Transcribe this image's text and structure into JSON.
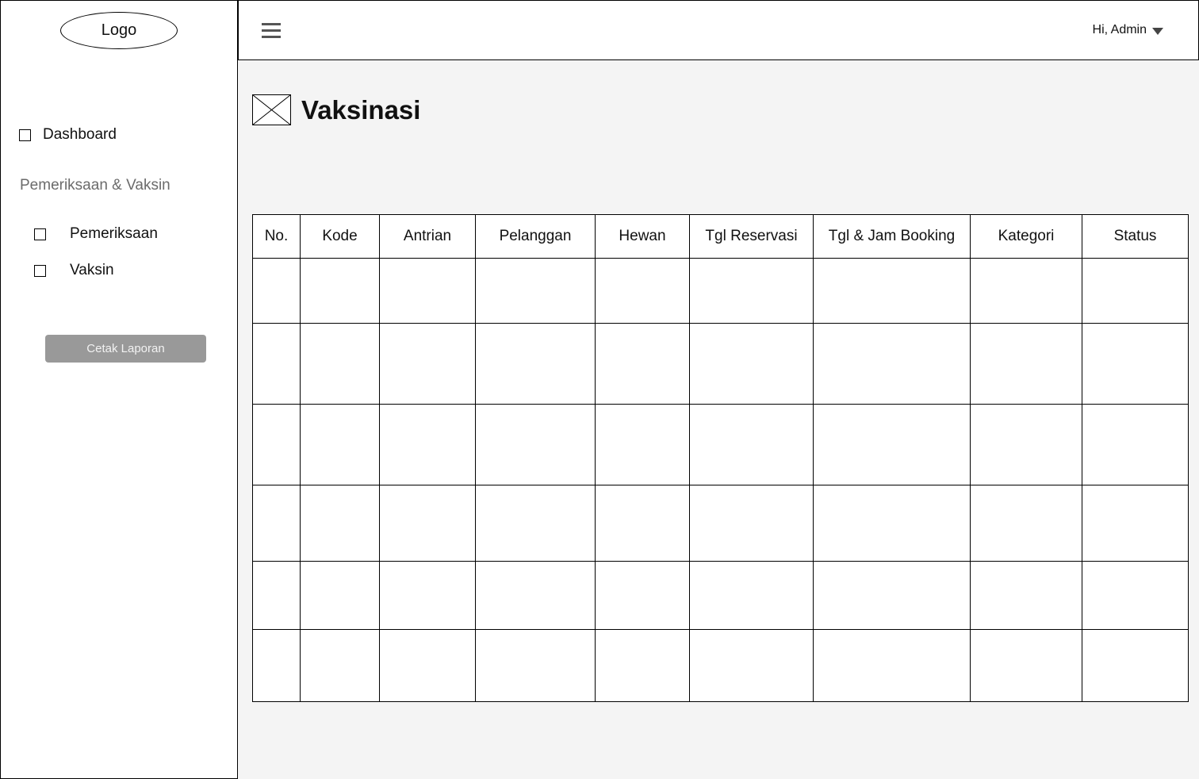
{
  "sidebar": {
    "logo": "Logo",
    "dashboard": "Dashboard",
    "section_title": "Pemeriksaan & Vaksin",
    "items": [
      {
        "label": "Pemeriksaan"
      },
      {
        "label": "Vaksin"
      }
    ],
    "print_button": "Cetak Laporan"
  },
  "header": {
    "menu_icon": "hamburger-icon",
    "greeting": "Hi, Admin",
    "caret_icon": "caret-down-icon"
  },
  "page": {
    "icon": "image-placeholder-icon",
    "title": "Vaksinasi"
  },
  "table": {
    "columns": [
      "No.",
      "Kode",
      "Antrian",
      "Pelanggan",
      "Hewan",
      "Tgl Reservasi",
      "Tgl & Jam Booking",
      "Kategori",
      "Status"
    ],
    "rows": [
      [
        "",
        "",
        "",
        "",
        "",
        "",
        "",
        "",
        ""
      ],
      [
        "",
        "",
        "",
        "",
        "",
        "",
        "",
        "",
        ""
      ],
      [
        "",
        "",
        "",
        "",
        "",
        "",
        "",
        "",
        ""
      ],
      [
        "",
        "",
        "",
        "",
        "",
        "",
        "",
        "",
        ""
      ],
      [
        "",
        "",
        "",
        "",
        "",
        "",
        "",
        "",
        ""
      ],
      [
        "",
        "",
        "",
        "",
        "",
        "",
        "",
        "",
        ""
      ]
    ]
  },
  "colors": {
    "sidebar_bg": "#ffffff",
    "content_bg": "#f4f4f4",
    "button_bg": "#999999",
    "section_label": "#6b6b6b"
  }
}
